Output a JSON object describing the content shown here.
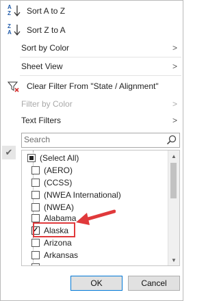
{
  "menu": {
    "sort_az": "Sort A to Z",
    "sort_za": "Sort Z to A",
    "sort_by_color": "Sort by Color",
    "sheet_view": "Sheet View",
    "clear_filter": "Clear Filter From \"State / Alignment\"",
    "filter_by_color": "Filter by Color",
    "text_filters": "Text Filters"
  },
  "search": {
    "placeholder": "Search"
  },
  "list": {
    "items": [
      {
        "label": "(Select All)",
        "state": "partial"
      },
      {
        "label": "(AERO)",
        "state": "unchecked"
      },
      {
        "label": "(CCSS)",
        "state": "unchecked"
      },
      {
        "label": "(NWEA International)",
        "state": "unchecked"
      },
      {
        "label": "(NWEA)",
        "state": "unchecked"
      },
      {
        "label": "Alabama",
        "state": "unchecked"
      },
      {
        "label": "Alaska",
        "state": "checked"
      },
      {
        "label": "Arizona",
        "state": "unchecked"
      },
      {
        "label": "Arkansas",
        "state": "unchecked"
      }
    ]
  },
  "buttons": {
    "ok": "OK",
    "cancel": "Cancel"
  },
  "colors": {
    "accent": "#0078d7",
    "annotation": "#e0393b"
  }
}
